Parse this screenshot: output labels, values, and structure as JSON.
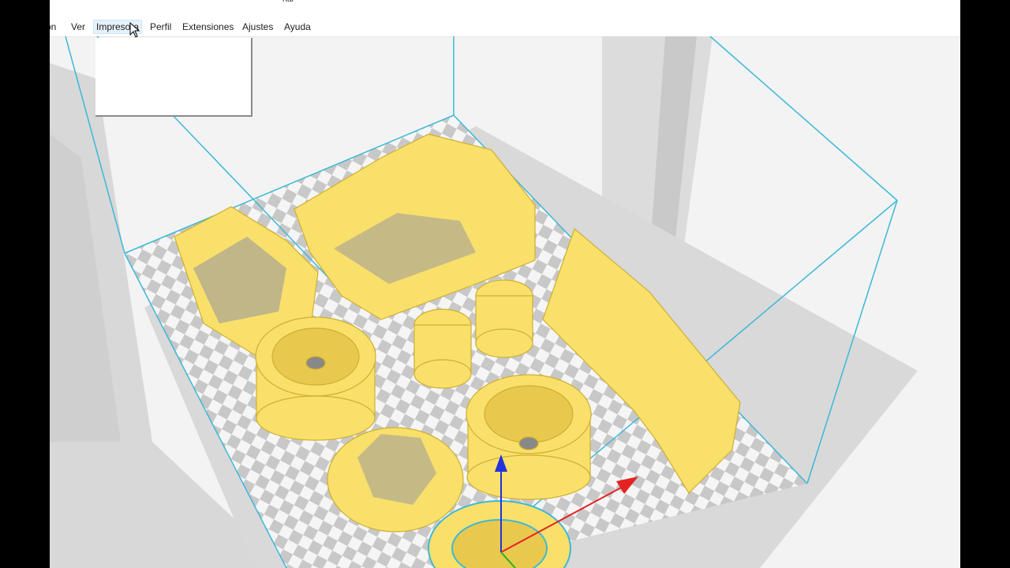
{
  "window": {
    "title": "rtal"
  },
  "menubar": {
    "items": [
      {
        "id": "archivo",
        "label": "on"
      },
      {
        "id": "ver",
        "label": "Ver"
      },
      {
        "id": "impresora",
        "label": "Impresora"
      },
      {
        "id": "perfil",
        "label": "Perfil"
      },
      {
        "id": "extensiones",
        "label": "Extensiones"
      },
      {
        "id": "ajustes",
        "label": "Ajustes"
      },
      {
        "id": "ayuda",
        "label": "Ayuda"
      }
    ],
    "active": "Impresora"
  },
  "scene": {
    "model_color": "#f9e06b",
    "model_shadow": "#d9b93c",
    "build_volume_color": "#3cb8d8",
    "plate_light": "#f5f5f5",
    "plate_dark": "#c8c8c8",
    "axis_colors": {
      "x": "#e52222",
      "y": "#22b322",
      "z": "#2233dd"
    }
  },
  "icons": [
    "arrow-cursor-icon",
    "x-axis-arrow-icon",
    "z-axis-arrow-icon"
  ]
}
